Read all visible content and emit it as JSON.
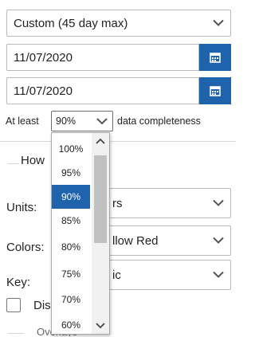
{
  "range_select": {
    "value": "Custom (45 day max)"
  },
  "start_date": {
    "value": "11/07/2020"
  },
  "end_date": {
    "value": "11/07/2020"
  },
  "completeness": {
    "prefix": "At least",
    "value": "90%",
    "suffix": "data completeness"
  },
  "section": {
    "partial_label": "How"
  },
  "units": {
    "label": "Units:",
    "value_fragment": "rs"
  },
  "colors": {
    "label": "Colors:",
    "value_fragment": "llow Red"
  },
  "key": {
    "label": "Key:",
    "value_fragment": "ic"
  },
  "display_checkbox": {
    "partial_label": "Dis"
  },
  "bottom": {
    "partial_label": "Overlays"
  },
  "dropdown": {
    "options": [
      "100%",
      "95%",
      "90%",
      "85%",
      "80%",
      "75%",
      "70%",
      "60%"
    ],
    "selected_index": 2
  },
  "colors_theme": {
    "accent": "#1f63ad",
    "border": "#b9b9b9"
  },
  "icons": [
    "chevron-down-icon",
    "calendar-icon",
    "chevron-up-icon"
  ]
}
